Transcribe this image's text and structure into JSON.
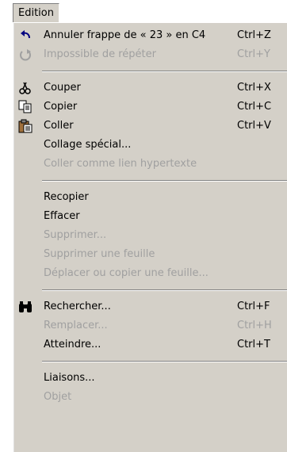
{
  "menubar": {
    "edition": "Edition"
  },
  "menu": {
    "items": [
      {
        "label": "Annuler frappe de « 23 » en C4",
        "shortcut": "Ctrl+Z"
      },
      {
        "label": "Impossible de répéter",
        "shortcut": "Ctrl+Y"
      },
      {
        "label": "Couper",
        "shortcut": "Ctrl+X"
      },
      {
        "label": "Copier",
        "shortcut": "Ctrl+C"
      },
      {
        "label": "Coller",
        "shortcut": "Ctrl+V"
      },
      {
        "label": "Collage spécial..."
      },
      {
        "label": "Coller comme lien hypertexte"
      },
      {
        "label": "Recopier"
      },
      {
        "label": "Effacer"
      },
      {
        "label": "Supprimer..."
      },
      {
        "label": "Supprimer une feuille"
      },
      {
        "label": "Déplacer ou copier une feuille..."
      },
      {
        "label": "Rechercher...",
        "shortcut": "Ctrl+F"
      },
      {
        "label": "Remplacer...",
        "shortcut": "Ctrl+H"
      },
      {
        "label": "Atteindre...",
        "shortcut": "Ctrl+T"
      },
      {
        "label": "Liaisons..."
      },
      {
        "label": "Objet"
      }
    ]
  }
}
